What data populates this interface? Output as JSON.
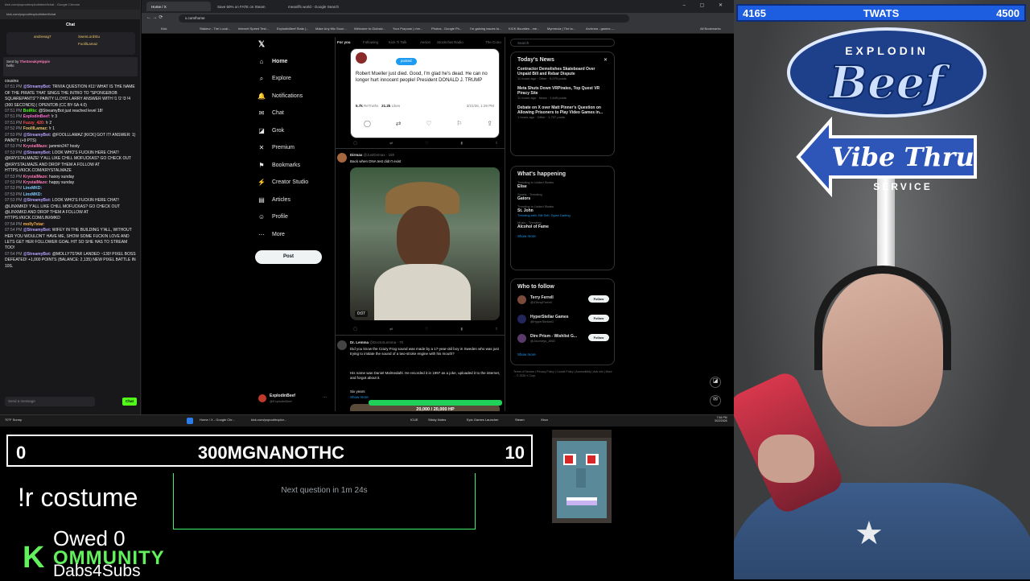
{
  "chat_window": {
    "title": "kick.com/popout/explodinbeef/chat - Google Chrome",
    "url": "kick.com/popout/explodinbeef/chat",
    "header": "Chat",
    "gifts": [
      "andreeag7",
      "SwenLordStu",
      "FoolllLamaz"
    ],
    "pinned": {
      "who": "TheSneakyHippie",
      "prefix": "Sent by",
      "text": "hello"
    },
    "lines": [
      {
        "t": "",
        "u": "",
        "c": "#e6e6e6",
        "m": "cousins"
      },
      {
        "t": "07:51 PM",
        "u": "@StreamyBot:",
        "c": "#b9a4ff",
        "m": "TRIVIA QUESTION #11! WHAT IS THE NAME OF THE PIRATE THAT SINGS THE INTRO TO \"SPONGEBOB SQUAREPANTS\"? PAINTY LLOYD LARRY ANSWER WITH !1 !2 !3 !4 (300 SECONDS) | OPENTDB (CC BY-SA 4.0)"
      },
      {
        "t": "07:51 PM",
        "u": "BotRix:",
        "c": "#53fc18",
        "m": "@StreamyBot just reached level 18!"
      },
      {
        "t": "07:51 PM",
        "u": "ExplodinBeef:",
        "c": "#ff6bd0",
        "m": "!r 3"
      },
      {
        "t": "07:51 PM",
        "u": "Fuzzy_420:",
        "c": "#ff4d4d",
        "m": "!r 2"
      },
      {
        "t": "07:52 PM",
        "u": "FoolllLamaz:",
        "c": "#e9c46a",
        "m": "!r 1"
      },
      {
        "t": "07:53 PM",
        "u": "@StreamyBot:",
        "c": "#b9a4ff",
        "m": "@FOOLLLAMAZ [KICK] GOT IT! ANSWER: 1) PAINTY (+9 PTS)"
      },
      {
        "t": "07:53 PM",
        "u": "KrystalMaze:",
        "c": "#ff7ab8",
        "m": "jammin247 hosty"
      },
      {
        "t": "07:53 PM",
        "u": "@StreamyBot:",
        "c": "#b9a4ff",
        "m": "LOOK WHO'S FUCKIN HERE CHAT! @KRYSTALMAZE! Y'ALL LIKE CHILL MOFUCKAS? GO CHECK OUT @KRYSTALMAZE AND DROP THEM A FOLLOW AT HTTPS://KICK.COM/KRYSTALMAZE"
      },
      {
        "t": "07:53 PM",
        "u": "KrystalMaze:",
        "c": "#ff7ab8",
        "m": "haooy sunday"
      },
      {
        "t": "07:53 PM",
        "u": "KrystalMaze:",
        "c": "#ff7ab8",
        "m": "happy sunday"
      },
      {
        "t": "07:53 PM",
        "u": "LinxMKD:",
        "c": "#7ecbff",
        "m": ""
      },
      {
        "t": "07:53 PM",
        "u": "LinxMKD:",
        "c": "#7ecbff",
        "m": ""
      },
      {
        "t": "07:53 PM",
        "u": "@StreamyBot:",
        "c": "#b9a4ff",
        "m": "LOOK WHO'S FUCKIN HERE CHAT! @LINXMKD! Y'ALL LIKE CHILL MOFUCKAS? GO CHECK OUT @LINXMKD AND DROP THEM A FOLLOW AT HTTPS://KICK.COM/LINXMKD"
      },
      {
        "t": "07:54 PM",
        "u": "molly7star:",
        "c": "#ffb347",
        "m": ""
      },
      {
        "t": "07:54 PM",
        "u": "@StreamyBot:",
        "c": "#b9a4ff",
        "m": "WIFEY IN THE BUILDING Y'ALL, WITHOUT HER YOU WOULDN'T HAVE ME, SHOW SOME FUCKIN LOVE AND LETS GET HER FOLLOWER GOAL HIT SO SHE HAS TO STREAM TOO!"
      },
      {
        "t": "07:54 PM",
        "u": "@StreamyBot:",
        "c": "#b9a4ff",
        "m": "@MOLLY7STAR LANDED ~130! PIXEL BOSS DEFEATED! +1,000 POINTS (BALANCE: 2,135) NEW PIXEL BATTLE IN 10S."
      }
    ],
    "input_placeholder": "Send a message",
    "send_label": "Chat"
  },
  "browser": {
    "tabs": [
      "Home / X",
      "Save 50% on FATE on Steam",
      "meaniffs world - Google Search"
    ],
    "url": "x.com/home",
    "bookmarks": [
      "Kick",
      "Stakeur - The Local...",
      "Internet Speed Test...",
      "ExplodinBeef Stats |...",
      "Make Any Mic Soun...",
      "Welcome to Globalv...",
      "Your Purpose | r/ve...",
      "Photos - Google Ph...",
      "I'm gaining issues to...",
      "KICK Bounties - me...",
      "Myrmecia | The la...",
      "Archnea - games -...",
      "All Bookmarks"
    ]
  },
  "x": {
    "nav": [
      {
        "name": "home",
        "icon": "⌂",
        "label": "Home"
      },
      {
        "name": "explore",
        "icon": "⌕",
        "label": "Explore"
      },
      {
        "name": "notifications",
        "icon": "🔔",
        "label": "Notifications"
      },
      {
        "name": "chat",
        "icon": "✉",
        "label": "Chat"
      },
      {
        "name": "grok",
        "icon": "◪",
        "label": "Grok"
      },
      {
        "name": "premium",
        "icon": "✕",
        "label": "Premium"
      },
      {
        "name": "bookmarks",
        "icon": "⚑",
        "label": "Bookmarks"
      },
      {
        "name": "creator-studio",
        "icon": "⚡",
        "label": "Creator Studio"
      },
      {
        "name": "articles",
        "icon": "▤",
        "label": "Articles"
      },
      {
        "name": "profile",
        "icon": "☺",
        "label": "Profile"
      },
      {
        "name": "more",
        "icon": "⋯",
        "label": "More"
      }
    ],
    "post_label": "Post",
    "profile": {
      "name": "ExplodinBeef",
      "handle": "@ExplodinBeef"
    },
    "timeline_tabs": [
      "For you",
      "Following",
      "Kick Ti Talk",
      "Aerion",
      "Stockchat Radio",
      "The Cono"
    ],
    "tweet1": {
      "badge": "posted",
      "text": "Robert Mueller just died. Good, I'm glad he's dead. He can no longer hurt innocent people! President DONALD J. TRUMP",
      "retruths": "5.7k",
      "retruths_label": "ReTruths",
      "likes": "21.2k",
      "likes_label": "Likes",
      "date": "3/21/26, 1:26 PM"
    },
    "tweet2": {
      "author": "Dirmax",
      "handle": "@JustDirmax · 15h",
      "text": "Back when DNA test didn't exist",
      "video_time": "0:07"
    },
    "tweet3": {
      "author": "Dr. Lemma",
      "handle": "@DoctorLemma · 7h",
      "text1": "Did you know the Crazy Frog sound was made by a 17-year-old boy in Sweden who was just trying to imitate the sound of a two-stroke engine with his mouth?",
      "text2": "His name was Daniel Malmedahl. He recorded it in 1997 as a joke, uploaded it to the internet, and forgot about it.",
      "text3": "Six years",
      "show_more": "Show more"
    },
    "search_placeholder": "Search",
    "news": {
      "title": "Today's News",
      "items": [
        {
          "headline": "Contractor Demolishes Skateboard Over Unpaid Bill and Rebar Dispute",
          "meta": "11 hours ago · Other · 5,070 posts"
        },
        {
          "headline": "Meta Shuts Down VRPirates, Top Quest VR Piracy Site",
          "meta": "11 hours ago · News · 1,645 posts"
        },
        {
          "headline": "Debate on X over Matt Pinner's Question on Allowing Prisoners to Play Video Games in...",
          "meta": "1 hours ago · Other · 1,737 posts"
        }
      ]
    },
    "happening": {
      "title": "What's happening",
      "items": [
        {
          "cat": "Trending in United States",
          "name": "Elise"
        },
        {
          "cat": "Sports · Trending",
          "name": "Gators"
        },
        {
          "cat": "Trending in United States",
          "name": "St. John",
          "sub": "Trending with: Bill Self, Dylan Darling"
        },
        {
          "cat": "Music · Trending",
          "name": "Alcohol of Fame"
        }
      ],
      "show_more": "Show more"
    },
    "who_to_follow": {
      "title": "Who to follow",
      "users": [
        {
          "name": "Terry Ferrell",
          "handle": "@4TerryFerrell"
        },
        {
          "name": "HyperStellar Games",
          "handle": "@HyperStellarG"
        },
        {
          "name": "Dire Prism - Wishlist G...",
          "handle": "@Journeys_AND"
        }
      ],
      "follow_label": "Follow",
      "show_more": "Show more"
    },
    "footer": "Terms of Service | Privacy Policy | Cookie Policy | Accessibility | Ads info | More ... © 2026 X Corp."
  },
  "hp": {
    "text": "20,000 / 20,000 HP",
    "fraction": 1.0
  },
  "taskbar": {
    "weather": "70°F Sunny",
    "items": [
      "Home / X - Google Chr...",
      "kick.com/popout/explor...",
      "ICUE",
      "Sticky Notes",
      "Epic Games Launcher",
      "Steam",
      "Xbox"
    ],
    "time": "7:54 PM",
    "date": "3/22/2026"
  },
  "overlay": {
    "top_left": "4165",
    "top_label": "TWATS",
    "top_right": "4500",
    "timer_left": "0",
    "timer_center": "300MGNANOTHC",
    "timer_right": "10",
    "command": "!r costume",
    "next_question": "Next question in 1m 24s",
    "owed": "Owed 0",
    "kommunity_k": "K",
    "kommunity_rest": "OMMUNITY",
    "dabs": "Dabs4Subs",
    "logo_top": "EXPLODIN",
    "logo_beef": "Beef",
    "logo_vibe": "Vibe Thru",
    "logo_service": "SERVICE"
  },
  "colors": {
    "accent_green": "#53fc18",
    "hud_blue": "#1d5de0",
    "x_blue": "#1d9bf0",
    "hp_green": "#1fd158"
  }
}
